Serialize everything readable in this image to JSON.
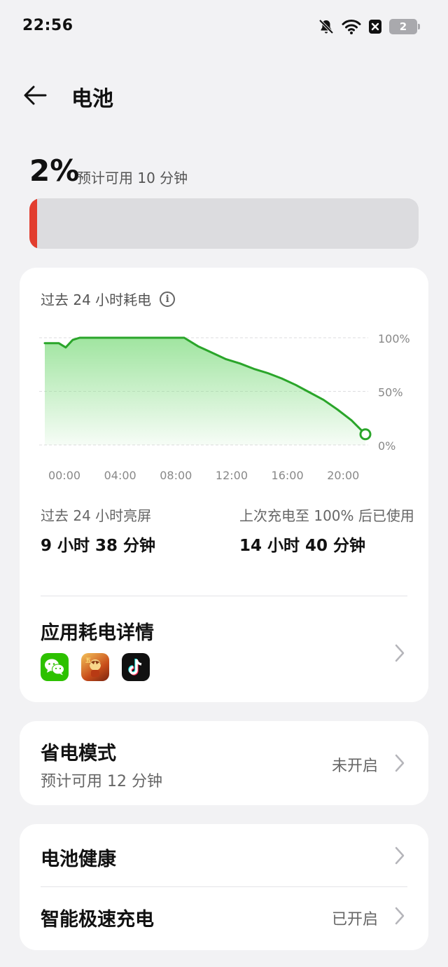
{
  "status_bar": {
    "time": "22:56",
    "battery_level": "2",
    "icons": [
      "notifications-off-icon",
      "wifi-icon",
      "close-box-icon",
      "battery-icon"
    ]
  },
  "header": {
    "back_icon": "arrow-left-icon",
    "title": "电池"
  },
  "battery": {
    "percent": "2%",
    "estimate": "预计可用 10 分钟",
    "level_fraction": 0.02,
    "level_color": "#e23d2e"
  },
  "usage_card": {
    "section_title": "过去 24 小时耗电",
    "info_icon": "info-icon",
    "stats": {
      "screen_label": "过去 24 小时亮屏",
      "screen_value": "9 小时 38 分钟",
      "since_charge_label": "上次充电至 100% 后已使用",
      "since_charge_value": "14 小时 40 分钟"
    },
    "app_details": {
      "title": "应用耗电详情",
      "apps": [
        "wechat-icon",
        "game-icon",
        "tiktok-icon"
      ]
    }
  },
  "chart_data": {
    "type": "area",
    "x_ticks": [
      "00:00",
      "04:00",
      "08:00",
      "12:00",
      "16:00",
      "20:00"
    ],
    "y_ticks": [
      "100%",
      "50%",
      "0%"
    ],
    "ylim": [
      0,
      100
    ],
    "xlim": [
      0,
      23.0
    ],
    "grid": true,
    "line_color": "#2aa52a",
    "fill_color": "#8fe08f",
    "series": [
      {
        "x": [
          0,
          1.0,
          1.5,
          2.0,
          2.5,
          3,
          4,
          5,
          6,
          7,
          8,
          9,
          10,
          11,
          11.5,
          12,
          13,
          14,
          15,
          16,
          17,
          18,
          19,
          20,
          21,
          22,
          23.0
        ],
        "y": [
          95,
          95,
          91,
          98,
          100,
          100,
          100,
          100,
          100,
          100,
          100,
          100,
          100,
          92,
          89,
          86,
          80,
          76,
          71,
          67,
          62,
          56,
          49,
          42,
          33,
          23,
          10
        ]
      }
    ],
    "end_marker": {
      "x": 23.0,
      "y": 10
    }
  },
  "power_save": {
    "title": "省电模式",
    "subtitle": "预计可用 12 分钟",
    "status": "未开启"
  },
  "health_card": {
    "health_label": "电池健康",
    "fast_charge_label": "智能极速充电",
    "fast_charge_status": "已开启"
  }
}
